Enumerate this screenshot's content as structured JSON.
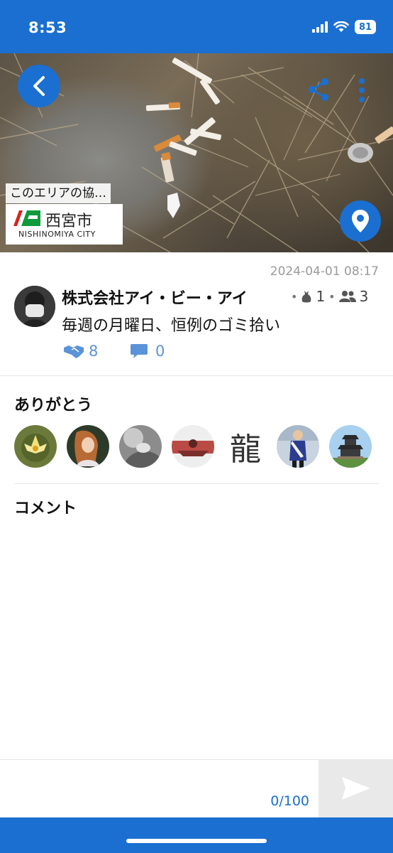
{
  "status_bar": {
    "time": "8:53",
    "battery": "81"
  },
  "post": {
    "area_label": "このエリアの協…",
    "city_name_jp": "西宮市",
    "city_name_en": "NISHINOMIYA CITY",
    "timestamp": "2024-04-01 08:17",
    "organization": "株式会社アイ・ビー・アイ",
    "bag_count": "1",
    "member_count": "3",
    "text": "毎週の月曜日、恒例のゴミ拾い",
    "thanks_count": "8",
    "comment_count": "0"
  },
  "thanks_section": {
    "title": "ありがとう",
    "users": [
      {
        "icon": "lotus-flower-avatar"
      },
      {
        "icon": "painting-girl-avatar"
      },
      {
        "icon": "grayscale-photo-avatar"
      },
      {
        "icon": "sunset-pose-avatar"
      },
      {
        "icon": "kanji-calligraphy-avatar",
        "kanji": "龍"
      },
      {
        "icon": "person-sash-avatar"
      },
      {
        "icon": "castle-avatar"
      }
    ]
  },
  "comments_section": {
    "title": "コメント"
  },
  "comment_input": {
    "counter": "0/100"
  },
  "colors": {
    "accent": "#1a6fd1",
    "link": "#5b93d8"
  }
}
